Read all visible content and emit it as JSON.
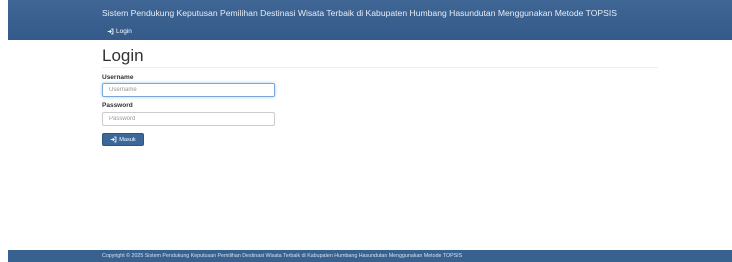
{
  "header": {
    "site_title": "Sistem Pendukung Keputusan Pemilihan Destinasi Wisata Terbaik di Kabupaten Humbang Hasundutan Menggunakan Metode TOPSIS",
    "nav": {
      "login_label": "Login",
      "login_icon": "sign-in-icon"
    }
  },
  "main": {
    "title": "Login",
    "form": {
      "username": {
        "label": "Username",
        "placeholder": "Username",
        "value": ""
      },
      "password": {
        "label": "Password",
        "placeholder": "Password",
        "value": ""
      },
      "submit": {
        "label": "Masuk",
        "icon": "sign-in-icon"
      }
    }
  },
  "footer": {
    "copyright": "Copyright © 2025 Sistem Pendukung Keputusan Pemilihan Destinasi Wisata Terbaik di Kabupaten Humbang Hasundutan Menggunakan Metode TOPSIS"
  },
  "colors": {
    "navbar": "#335a88",
    "footer": "#37618f",
    "primary_button": "#3b6799",
    "focus_border": "#7aa7d6"
  }
}
